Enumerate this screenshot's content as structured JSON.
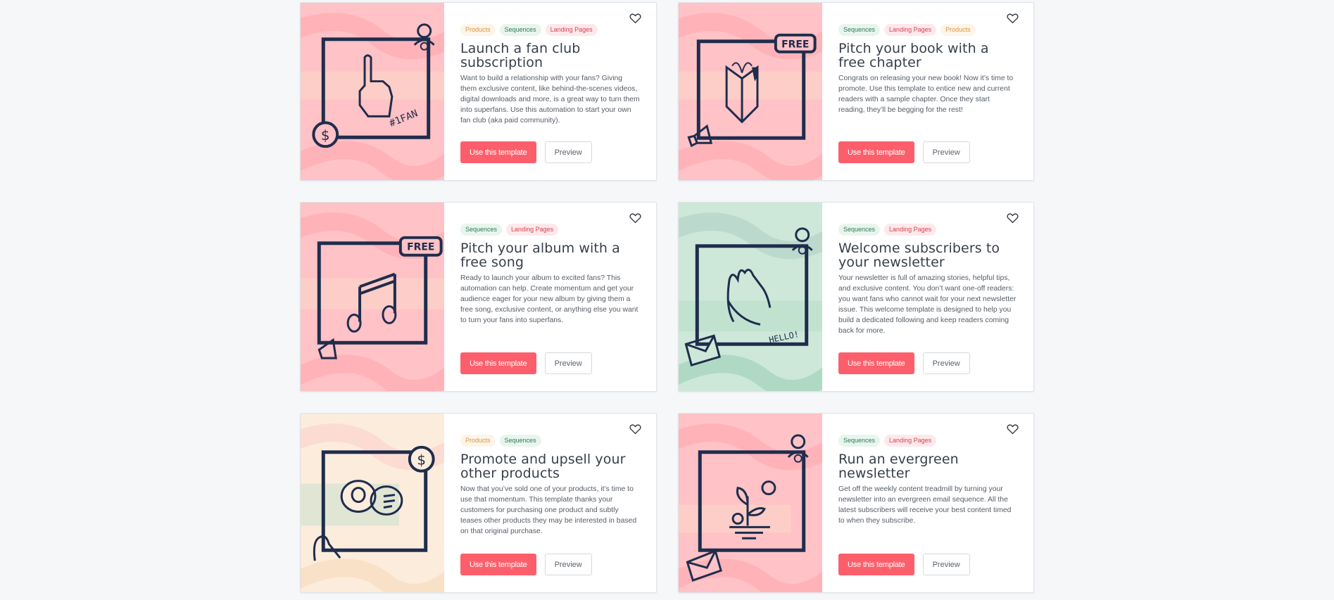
{
  "colors": {
    "background": "#f5f7f9",
    "primary_button": "#fc5f6b",
    "tag_products": "#d8973a",
    "tag_sequences": "#2f7a55",
    "tag_landing_pages": "#d9414f",
    "illustration_ink": "#1f2d4d"
  },
  "cards": [
    {
      "tags": [
        "Products",
        "Sequences",
        "Landing Pages"
      ],
      "title": "Launch a fan club subscription",
      "description": "Want to build a relationship with your fans? Giving them exclusive content, like behind-the-scenes videos, digital downloads and more, is a great way to turn them into superfans. Use this automation to start your own fan club (aka paid community).",
      "illustration": "number-one-fan-hand",
      "illustration_text": "#1FAN",
      "theme": "pink",
      "primary_label": "Use this template",
      "secondary_label": "Preview"
    },
    {
      "tags": [
        "Sequences",
        "Landing Pages",
        "Products"
      ],
      "title": "Pitch your book with a free chapter",
      "description": "Congrats on releasing your new book! Now it’s time to promote. Use this template to entice new and current readers with a sample chapter. Once they start reading, they’ll be begging for the rest!",
      "illustration": "open-book",
      "illustration_text": "FREE",
      "theme": "pink",
      "primary_label": "Use this template",
      "secondary_label": "Preview"
    },
    {
      "tags": [
        "Sequences",
        "Landing Pages"
      ],
      "title": "Pitch your album with a free song",
      "description": "Ready to launch your album to excited fans? This automation can help. Create momentum and get your audience eager for your new album by giving them a free song, exclusive content, or anything else you want to turn your fans into superfans.",
      "illustration": "music-note",
      "illustration_text": "FREE",
      "theme": "pink",
      "primary_label": "Use this template",
      "secondary_label": "Preview"
    },
    {
      "tags": [
        "Sequences",
        "Landing Pages"
      ],
      "title": "Welcome subscribers to your newsletter",
      "description": "Your newsletter is full of amazing stories, helpful tips, and exclusive content. You don’t want one-off readers: you want fans who cannot wait for your next newsletter issue. This welcome template is designed to help you build a dedicated following and keep readers coming back for more.",
      "illustration": "waving-hand",
      "illustration_text": "HELLO!",
      "theme": "green",
      "primary_label": "Use this template",
      "secondary_label": "Preview"
    },
    {
      "tags": [
        "Products",
        "Sequences"
      ],
      "title": "Promote and upsell your other products",
      "description": "Now that you’ve sold one of your products, it’s time to use that momentum. This template thanks your customers for purchasing one product and subtly teases other products they may be interested in based on that original purchase.",
      "illustration": "chat-bubbles",
      "illustration_text": "",
      "theme": "cream",
      "primary_label": "Use this template",
      "secondary_label": "Preview"
    },
    {
      "tags": [
        "Sequences",
        "Landing Pages"
      ],
      "title": "Run an evergreen newsletter",
      "description": "Get off the weekly content treadmill by turning your newsletter into an evergreen email sequence. All the latest subscribers will receive your best content timed to when they subscribe.",
      "illustration": "sprouting-plant",
      "illustration_text": "",
      "theme": "pink",
      "primary_label": "Use this template",
      "secondary_label": "Preview"
    }
  ]
}
